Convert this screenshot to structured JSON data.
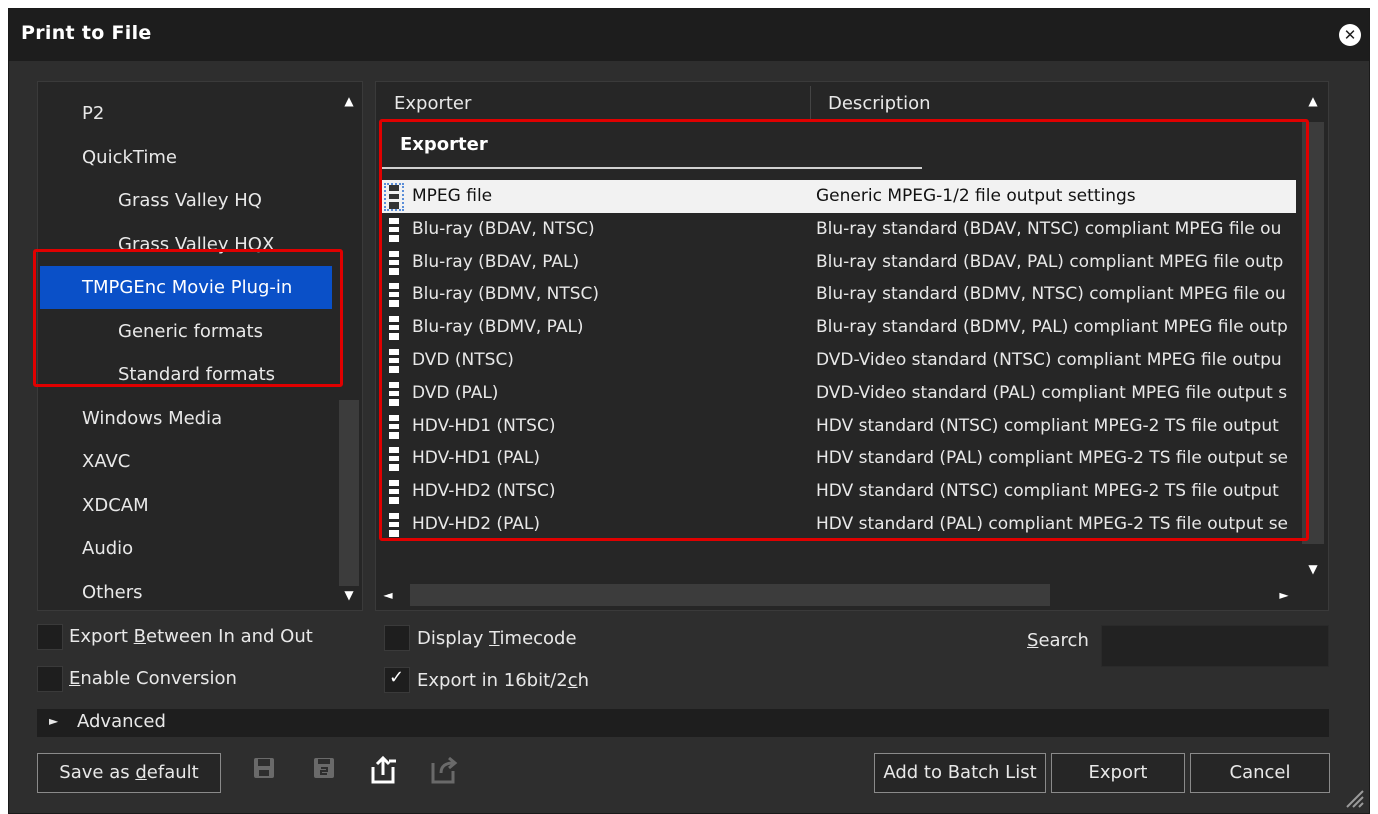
{
  "window": {
    "title": "Print to File"
  },
  "tree": {
    "items": [
      {
        "label": "P2",
        "level": 1
      },
      {
        "label": "QuickTime",
        "level": 1
      },
      {
        "label": "Grass Valley HQ",
        "level": 2
      },
      {
        "label": "Grass Valley HQX",
        "level": 2
      },
      {
        "label": "TMPGEnc Movie Plug-in",
        "level": 1,
        "selected": true
      },
      {
        "label": "Generic formats",
        "level": 2
      },
      {
        "label": "Standard formats",
        "level": 2
      },
      {
        "label": "Windows Media",
        "level": 1
      },
      {
        "label": "XAVC",
        "level": 1
      },
      {
        "label": "XDCAM",
        "level": 1
      },
      {
        "label": "Audio",
        "level": 1
      },
      {
        "label": "Others",
        "level": 1
      }
    ]
  },
  "list": {
    "columns": {
      "exporter": "Exporter",
      "description": "Description"
    },
    "group": "Exporter",
    "rows": [
      {
        "name": "MPEG file",
        "description": "Generic MPEG-1/2 file output settings",
        "selected": true
      },
      {
        "name": "Blu-ray (BDAV, NTSC)",
        "description": "Blu-ray standard (BDAV, NTSC) compliant MPEG file ou"
      },
      {
        "name": "Blu-ray (BDAV, PAL)",
        "description": "Blu-ray standard (BDAV, PAL) compliant MPEG file outp"
      },
      {
        "name": "Blu-ray (BDMV, NTSC)",
        "description": "Blu-ray standard (BDMV, NTSC) compliant MPEG file ou"
      },
      {
        "name": "Blu-ray (BDMV, PAL)",
        "description": "Blu-ray standard (BDMV, PAL) compliant MPEG file outp"
      },
      {
        "name": "DVD (NTSC)",
        "description": "DVD-Video standard (NTSC) compliant MPEG file outpu"
      },
      {
        "name": "DVD (PAL)",
        "description": "DVD-Video standard (PAL) compliant MPEG file output s"
      },
      {
        "name": "HDV-HD1 (NTSC)",
        "description": "HDV standard (NTSC) compliant MPEG-2 TS file output"
      },
      {
        "name": "HDV-HD1 (PAL)",
        "description": "HDV standard (PAL) compliant MPEG-2 TS file output se"
      },
      {
        "name": "HDV-HD2 (NTSC)",
        "description": "HDV standard (NTSC) compliant MPEG-2 TS file output"
      },
      {
        "name": "HDV-HD2 (PAL)",
        "description": "HDV standard (PAL) compliant MPEG-2 TS file output se"
      }
    ]
  },
  "options": {
    "export_between": {
      "pre": "Export ",
      "key": "B",
      "post": "etween In and Out",
      "checked": false
    },
    "enable_conversion": {
      "pre": "",
      "key": "E",
      "post": "nable Conversion",
      "checked": false
    },
    "display_timecode": {
      "pre": "Display ",
      "key": "T",
      "post": "imecode",
      "checked": false
    },
    "export_16bit": {
      "pre": "Export in 16bit/2",
      "key": "c",
      "post": "h",
      "checked": true
    },
    "search_label": {
      "pre": "",
      "key": "S",
      "post": "earch"
    },
    "search_value": ""
  },
  "advanced": {
    "label": "Advanced"
  },
  "buttons": {
    "save_default": {
      "pre": "Save as ",
      "key": "d",
      "post": "efault"
    },
    "add_batch": "Add to Batch List",
    "export": "Export",
    "cancel": "Cancel"
  },
  "icons": {
    "save": "save-icon",
    "save_as": "save-as-icon",
    "import": "import-preset-icon",
    "export": "export-preset-icon"
  },
  "colors": {
    "selection": "#0a50c8",
    "highlight_box": "#e00000",
    "background": "#2e2e2e"
  }
}
